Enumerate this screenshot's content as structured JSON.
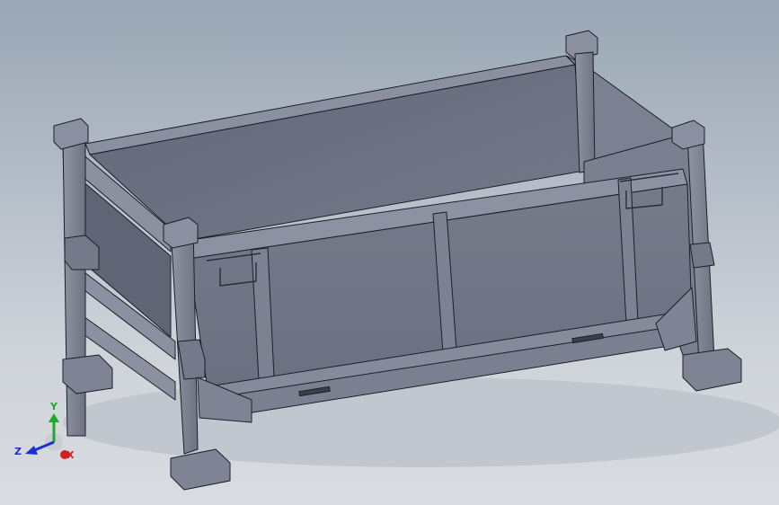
{
  "viewport": {
    "background_top": "#9aa6b4",
    "background_bottom": "#d9dce0",
    "model_color": "#6e7482",
    "edge_color": "#1c1f26"
  },
  "triad": {
    "x_label": "X",
    "y_label": "Y",
    "z_label": "Z",
    "x_color": "#d42020",
    "y_color": "#1fa82a",
    "z_color": "#1c2fd0"
  }
}
